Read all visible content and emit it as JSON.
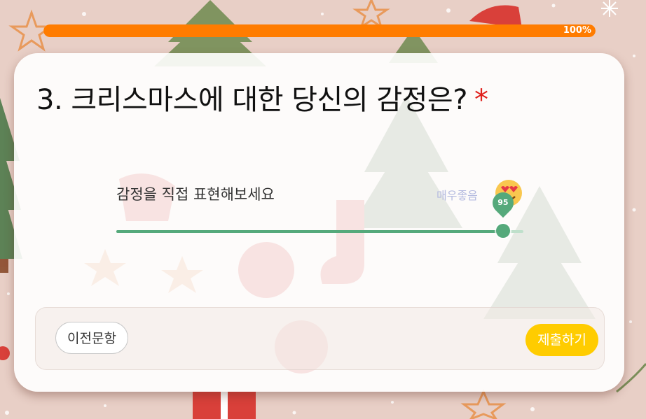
{
  "progress": {
    "value_percent": 100,
    "label": "100%"
  },
  "question": {
    "number_title": "3. 크리스마스에 대한 당신의 감정은?",
    "required_mark": "*"
  },
  "slider": {
    "prompt": "감정을 직접 표현해보세요",
    "max_label": "매우좋음",
    "value": 95,
    "value_label": "95",
    "min": 0,
    "max": 100,
    "emoji": "heart-eyes-face-icon"
  },
  "nav": {
    "prev_label": "이전문항",
    "submit_label": "제출하기"
  },
  "colors": {
    "progress": "#ff7c00",
    "slider": "#55a97b",
    "submit": "#ffcc00",
    "required": "#e0201c",
    "background": "#e8cfc6"
  }
}
